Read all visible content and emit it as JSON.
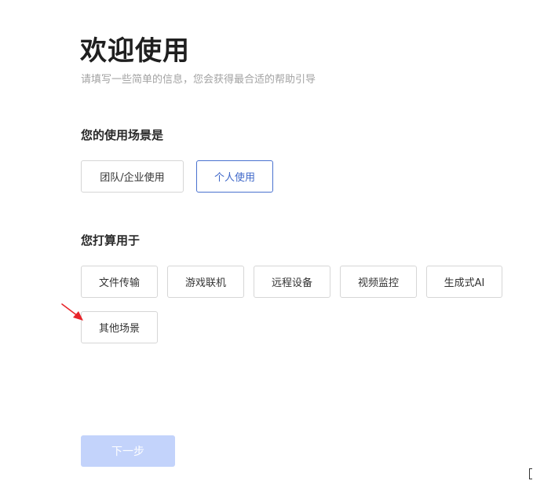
{
  "header": {
    "title": "欢迎使用",
    "subtitle": "请填写一些简单的信息，您会获得最合适的帮助引导"
  },
  "usage_scene": {
    "question": "您的使用场景是",
    "options": [
      {
        "label": "团队/企业使用",
        "selected": false
      },
      {
        "label": "个人使用",
        "selected": true
      }
    ]
  },
  "purpose": {
    "question": "您打算用于",
    "options": [
      {
        "label": "文件传输",
        "selected": false
      },
      {
        "label": "游戏联机",
        "selected": false
      },
      {
        "label": "远程设备",
        "selected": false
      },
      {
        "label": "视频监控",
        "selected": false
      },
      {
        "label": "生成式AI",
        "selected": false
      },
      {
        "label": "其他场景",
        "selected": false
      }
    ]
  },
  "footer": {
    "next_label": "下一步",
    "next_enabled": false
  },
  "colors": {
    "accent": "#4a72cf",
    "next_disabled_bg": "#c3d3fb",
    "annotation_arrow": "#e8242a"
  },
  "icons": {
    "annotation": "red-arrow-icon"
  }
}
